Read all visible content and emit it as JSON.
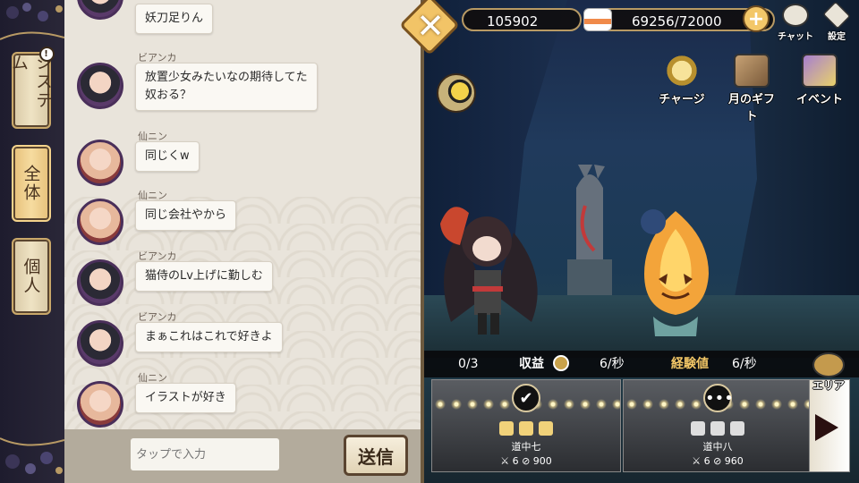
{
  "rail": {
    "tabs": [
      {
        "label": "システム",
        "badge": "!"
      },
      {
        "label": "全体"
      },
      {
        "label": "個人"
      }
    ]
  },
  "chat": {
    "messages": [
      {
        "name": "",
        "text": "妖刀足りん",
        "avatar": "bianca"
      },
      {
        "name": "ビアンカ",
        "text": "放置少女みたいなの期待してた\n奴おる？",
        "avatar": "bianca"
      },
      {
        "name": "仙ニン",
        "text": "同じくw",
        "avatar": "sennin"
      },
      {
        "name": "仙ニン",
        "text": "同じ会社やから",
        "avatar": "sennin"
      },
      {
        "name": "ビアンカ",
        "text": "猫侍のLv上げに勤しむ",
        "avatar": "bianca"
      },
      {
        "name": "ビアンカ",
        "text": "まぁこれはこれで好きよ",
        "avatar": "bianca"
      },
      {
        "name": "仙ニン",
        "text": "イラストが好き",
        "avatar": "sennin"
      }
    ],
    "input_placeholder": "タップで入力",
    "send_label": "送信"
  },
  "hud": {
    "coins": "105902",
    "stamina": "69256/72000",
    "plus_label": "+",
    "chat_label": "チャット",
    "settings_label": "設定",
    "close_label": "✕"
  },
  "events": [
    {
      "label": "チャージ",
      "icon": "charge-icon"
    },
    {
      "label": "月のギフト",
      "icon": "monthly-gift-icon"
    },
    {
      "label": "イベント",
      "icon": "event-icon"
    }
  ],
  "stats": {
    "progress": "0/3",
    "income_label": "収益",
    "income_rate": "6/秒",
    "exp_label": "経験値",
    "exp_rate": "6/秒"
  },
  "area_label": "エリア",
  "stages": [
    {
      "name": "道中七",
      "level": "6",
      "power": "900",
      "cleared": true
    },
    {
      "name": "道中八",
      "level": "6",
      "power": "960",
      "cleared": false
    }
  ],
  "colors": {
    "gold": "#f2c467",
    "chat_bg": "#e9e4db",
    "rail_bg": "#1e1c2e"
  }
}
